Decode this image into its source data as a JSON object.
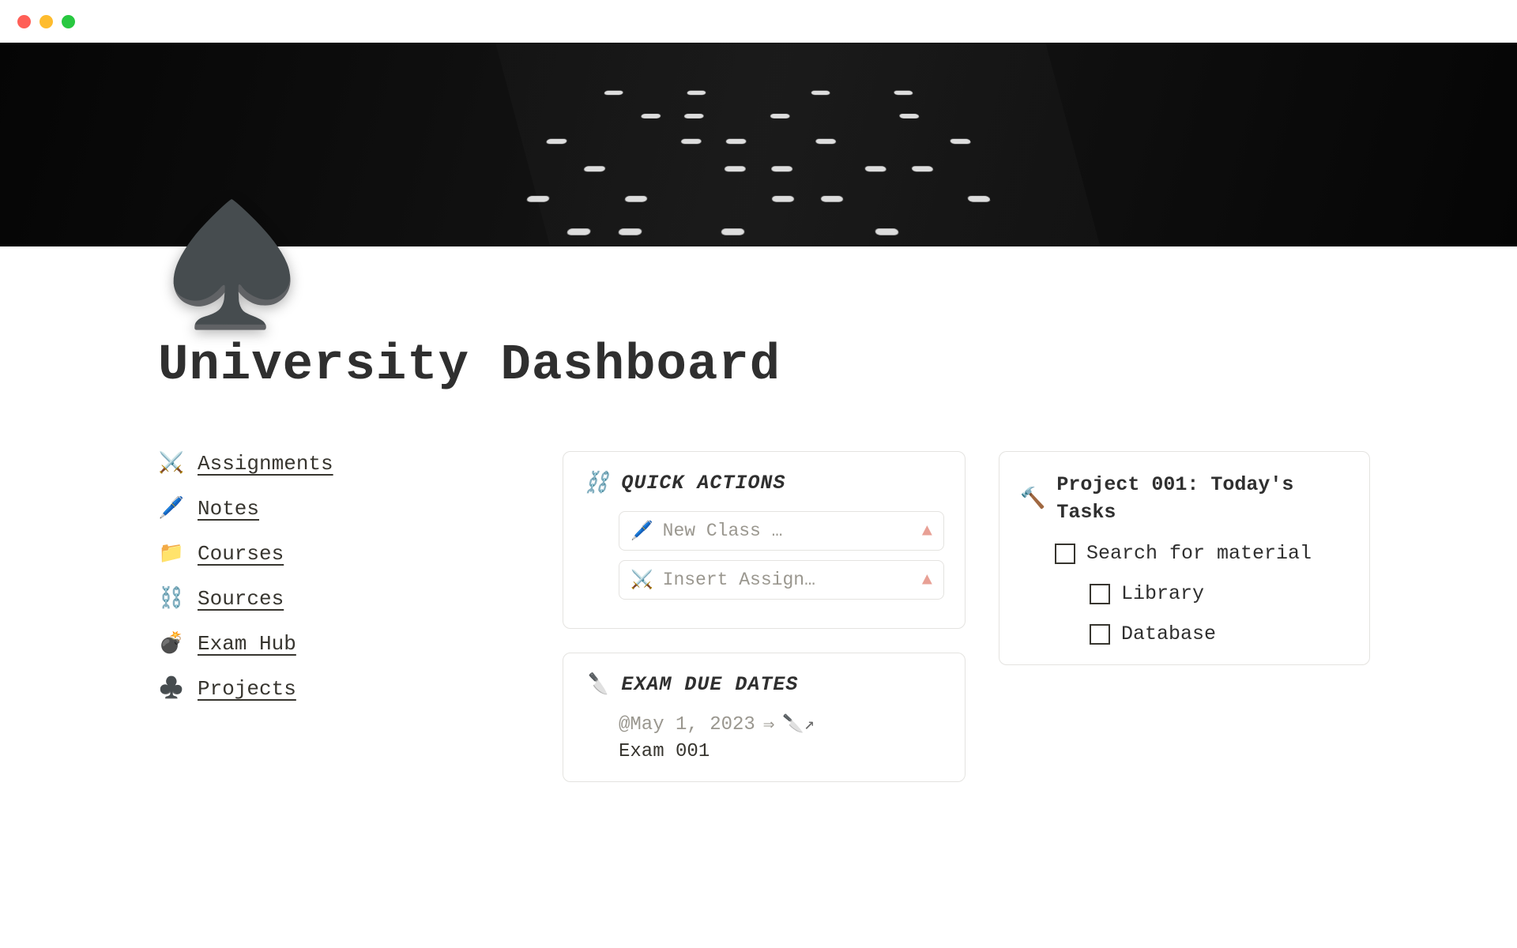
{
  "page": {
    "icon": "♠️",
    "title": "University Dashboard"
  },
  "nav": [
    {
      "icon": "⚔️",
      "label": "Assignments"
    },
    {
      "icon": "🖊️",
      "label": "Notes"
    },
    {
      "icon": "📁",
      "label": "Courses"
    },
    {
      "icon": "⛓️",
      "label": "Sources"
    },
    {
      "icon": "💣",
      "label": "Exam Hub"
    },
    {
      "icon": "♣️",
      "label": "Projects"
    }
  ],
  "quick": {
    "icon": "⛓️",
    "title": "QUICK ACTIONS",
    "actions": [
      {
        "icon": "🖊️",
        "label": "New Class …"
      },
      {
        "icon": "⚔️",
        "label": "Insert Assign…"
      }
    ]
  },
  "exams": {
    "icon": "🔪",
    "title": "EXAM DUE DATES",
    "date": "@May 1, 2023",
    "arrow": "⇒",
    "link_icon": "🔪↗",
    "name": "Exam 001"
  },
  "project": {
    "icon": "🔨",
    "title": "Project 001: Today's Tasks",
    "tasks": {
      "main": "Search for material",
      "subs": [
        "Library",
        "Database"
      ]
    }
  }
}
